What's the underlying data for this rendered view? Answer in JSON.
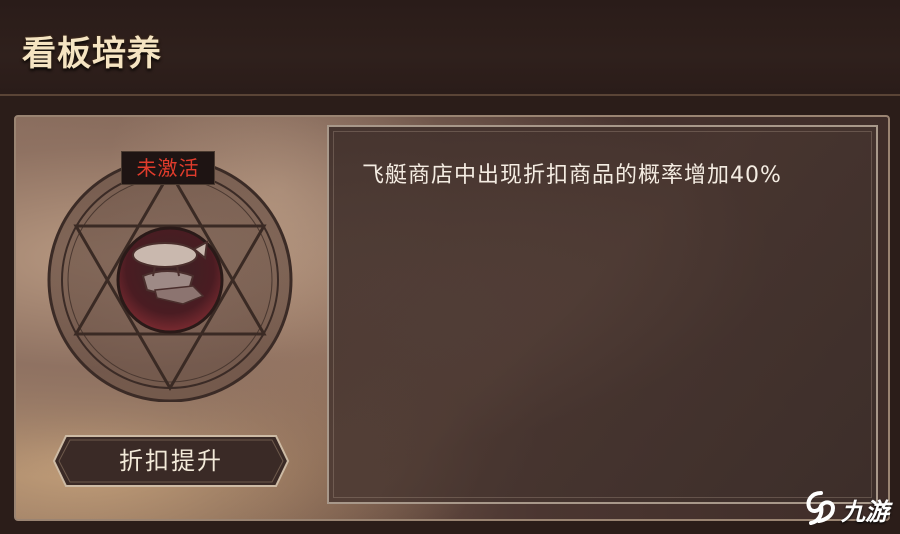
{
  "header": {
    "title": "看板培养"
  },
  "card": {
    "status_label": "未激活",
    "status_color": "#e13c2c",
    "emblem_icon": "airship-emblem-icon",
    "action_button_label": "折扣提升",
    "description": "飞艇商店中出现折扣商品的概率增加40%"
  },
  "watermark": {
    "text": "九游",
    "icon": "jiuyou-logo-icon"
  },
  "colors": {
    "header_title": "#f5e4c2",
    "panel_border": "#9a8472",
    "text_light": "#f4ece2"
  }
}
